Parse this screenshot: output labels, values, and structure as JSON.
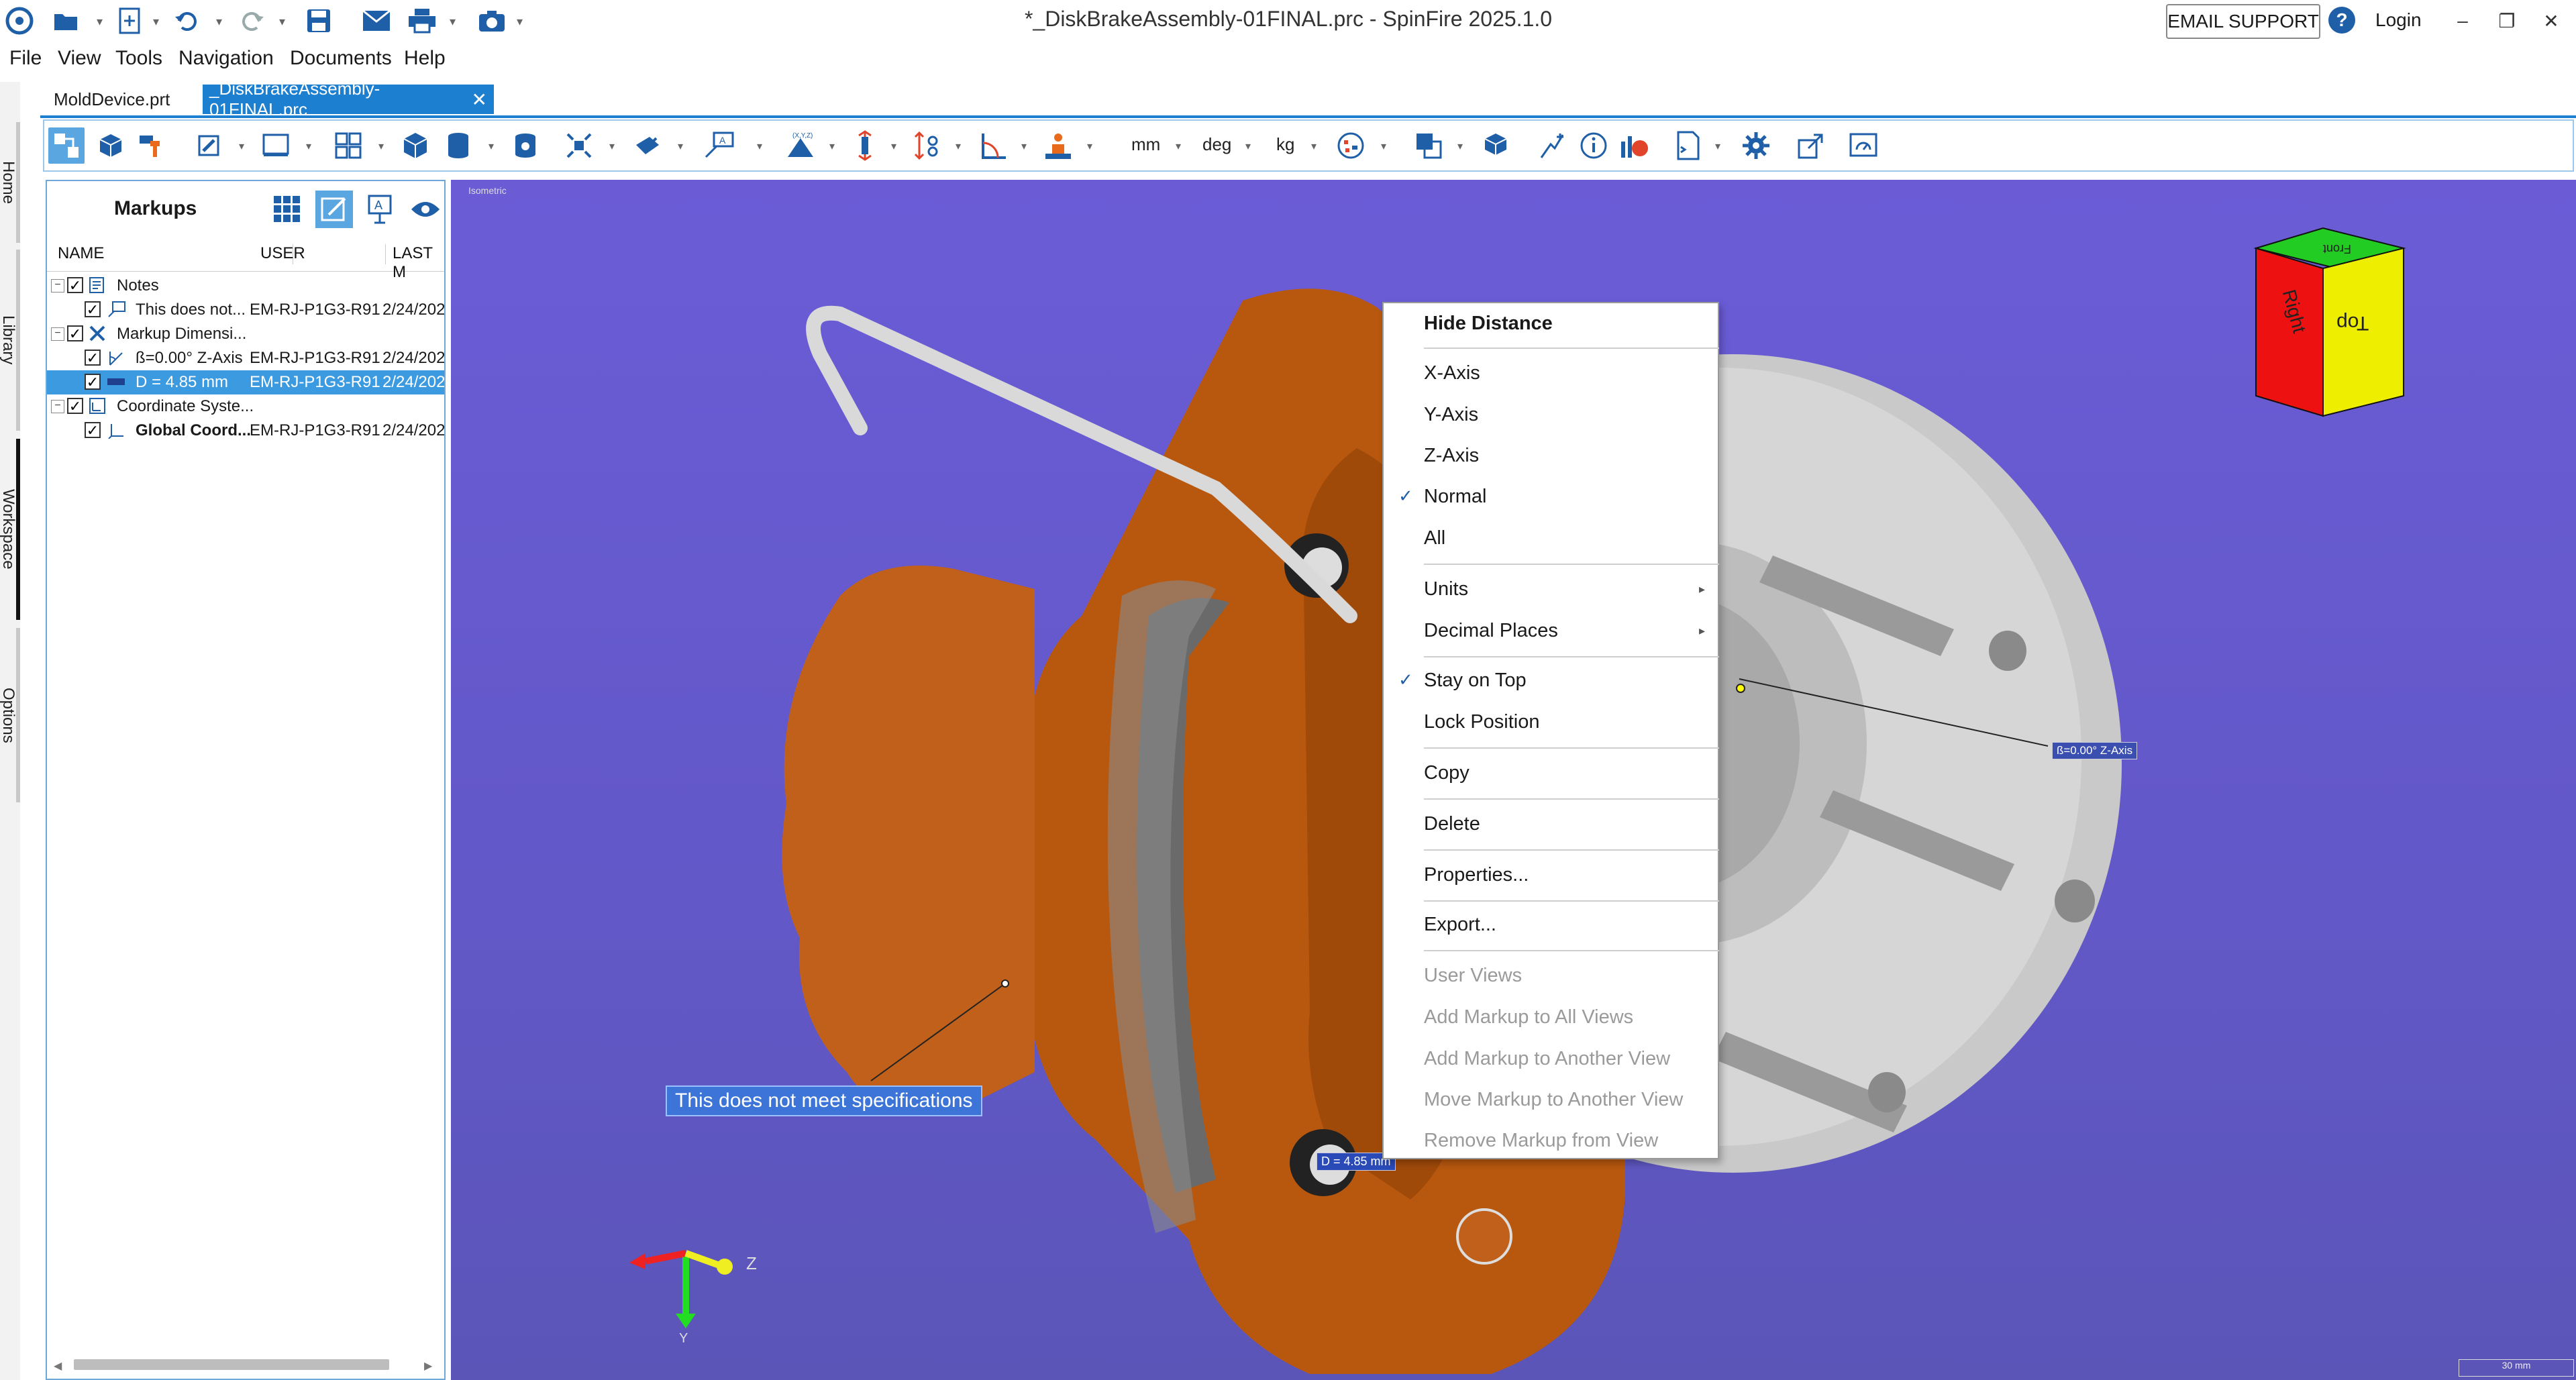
{
  "app": {
    "title": "*_DiskBrakeAssembly-01FINAL.prc - SpinFire 2025.1.0",
    "email_support": "EMAIL SUPPORT",
    "login": "Login",
    "help_glyph": "?",
    "minimize_glyph": "–",
    "restore_glyph": "❐",
    "close_glyph": "✕"
  },
  "menu": [
    "File",
    "View",
    "Tools",
    "Navigation",
    "Documents",
    "Help"
  ],
  "doc_tabs": {
    "inactive": "MoldDevice.prt",
    "active": "_DiskBrakeAssembly-01FINAL.prc",
    "close_glyph": "✕"
  },
  "left_nav": [
    "Home",
    "Library",
    "Workspace",
    "Options"
  ],
  "toolbar": {
    "units_length": "mm",
    "units_angle": "deg",
    "units_mass": "kg"
  },
  "panel": {
    "title": "Markups",
    "columns": [
      "NAME",
      "USER",
      "LAST M"
    ],
    "rows": [
      {
        "name": "Notes",
        "user": "",
        "date": "",
        "level": 0,
        "expander": "−"
      },
      {
        "name": "This does not...",
        "user": "EM-RJ-P1G3-R91...",
        "date": "2/24/202",
        "level": 1
      },
      {
        "name": "Markup Dimensi...",
        "user": "",
        "date": "",
        "level": 0,
        "expander": "−"
      },
      {
        "name": "ß=0.00° Z-Axis",
        "user": "EM-RJ-P1G3-R91...",
        "date": "2/24/202",
        "level": 1
      },
      {
        "name": "D = 4.85 mm",
        "user": "EM-RJ-P1G3-R91...",
        "date": "2/24/202",
        "level": 1,
        "selected": true
      },
      {
        "name": "Coordinate Syste...",
        "user": "",
        "date": "",
        "level": 0,
        "expander": "−"
      },
      {
        "name": "Global Coord...",
        "user": "EM-RJ-P1G3-R91...",
        "date": "2/24/202",
        "level": 1,
        "bold": true
      }
    ]
  },
  "viewport": {
    "view_name": "Isometric",
    "note": "This does not meet specifications",
    "distance_label": "D = 4.85 mm",
    "angle_label": "ß=0.00° Z-Axis",
    "scale_label": "30 mm",
    "cube": {
      "top_face": "Front",
      "left_face": "Right",
      "right_face": "Top"
    },
    "triad": {
      "z": "Z",
      "y": "Y"
    }
  },
  "context_menu": [
    {
      "label": "Hide Distance",
      "bold": true
    },
    {
      "sep": true
    },
    {
      "label": "X-Axis"
    },
    {
      "label": "Y-Axis"
    },
    {
      "label": "Z-Axis"
    },
    {
      "label": "Normal",
      "checked": true
    },
    {
      "label": "All"
    },
    {
      "sep": true
    },
    {
      "label": "Units",
      "submenu": true
    },
    {
      "label": "Decimal Places",
      "submenu": true
    },
    {
      "sep": true
    },
    {
      "label": "Stay on Top",
      "checked": true
    },
    {
      "label": "Lock Position"
    },
    {
      "sep": true
    },
    {
      "label": "Copy"
    },
    {
      "sep": true
    },
    {
      "label": "Delete"
    },
    {
      "sep": true
    },
    {
      "label": "Properties..."
    },
    {
      "sep": true
    },
    {
      "label": "Export..."
    },
    {
      "sep": true
    },
    {
      "label": "User Views",
      "disabled": true
    },
    {
      "label": "Add Markup to All Views",
      "disabled": true
    },
    {
      "label": "Add Markup to Another View",
      "disabled": true
    },
    {
      "label": "Move Markup to Another View",
      "disabled": true
    },
    {
      "label": "Remove Markup from View",
      "disabled": true
    }
  ],
  "colors": {
    "accent": "#1d7fd0",
    "viewport_bg": "#6b5cd6",
    "caliper": "#b8580f",
    "disc": "#d0d0d0",
    "cube_front": "#22cc22",
    "cube_right": "#ee1111",
    "cube_top": "#eeee00"
  }
}
